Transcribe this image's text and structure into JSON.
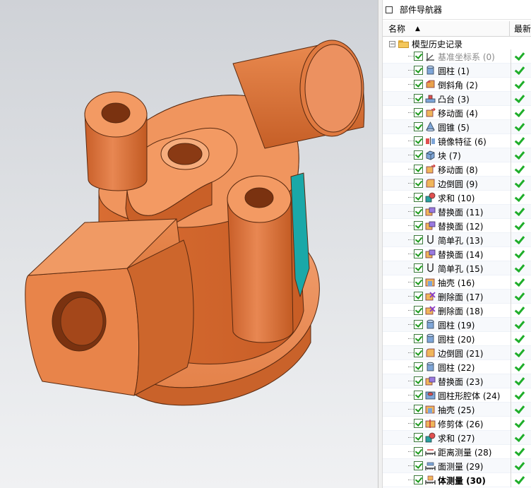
{
  "navigator": {
    "title": "部件导航器",
    "columns": {
      "name": "名称",
      "latest": "最新"
    },
    "root": {
      "label": "模型历史记录",
      "toggle": "−"
    },
    "features": [
      {
        "label": "基准坐标系 (0)",
        "icon": "datum-csys-icon",
        "muted": true
      },
      {
        "label": "圆柱 (1)",
        "icon": "cylinder-icon"
      },
      {
        "label": "倒斜角 (2)",
        "icon": "chamfer-icon"
      },
      {
        "label": "凸台 (3)",
        "icon": "boss-icon"
      },
      {
        "label": "移动面 (4)",
        "icon": "move-face-icon"
      },
      {
        "label": "圆锥 (5)",
        "icon": "cone-icon"
      },
      {
        "label": "镜像特征 (6)",
        "icon": "mirror-feature-icon"
      },
      {
        "label": "块 (7)",
        "icon": "block-icon"
      },
      {
        "label": "移动面 (8)",
        "icon": "move-face-icon"
      },
      {
        "label": "边倒圆 (9)",
        "icon": "edge-blend-icon"
      },
      {
        "label": "求和 (10)",
        "icon": "unite-icon"
      },
      {
        "label": "替换面 (11)",
        "icon": "replace-face-icon"
      },
      {
        "label": "替换面 (12)",
        "icon": "replace-face-icon"
      },
      {
        "label": "简单孔 (13)",
        "icon": "simple-hole-icon"
      },
      {
        "label": "替换面 (14)",
        "icon": "replace-face-icon"
      },
      {
        "label": "简单孔 (15)",
        "icon": "simple-hole-icon"
      },
      {
        "label": "抽壳 (16)",
        "icon": "shell-icon"
      },
      {
        "label": "删除面 (17)",
        "icon": "delete-face-icon"
      },
      {
        "label": "删除面 (18)",
        "icon": "delete-face-icon"
      },
      {
        "label": "圆柱 (19)",
        "icon": "cylinder-icon"
      },
      {
        "label": "圆柱 (20)",
        "icon": "cylinder-icon"
      },
      {
        "label": "边倒圆 (21)",
        "icon": "edge-blend-icon"
      },
      {
        "label": "圆柱 (22)",
        "icon": "cylinder-icon"
      },
      {
        "label": "替换面 (23)",
        "icon": "replace-face-icon"
      },
      {
        "label": "圆柱形腔体 (24)",
        "icon": "cylindrical-pocket-icon"
      },
      {
        "label": "抽壳 (25)",
        "icon": "shell-icon"
      },
      {
        "label": "修剪体 (26)",
        "icon": "trim-body-icon"
      },
      {
        "label": "求和 (27)",
        "icon": "unite-icon"
      },
      {
        "label": "距离测量 (28)",
        "icon": "distance-measure-icon"
      },
      {
        "label": "面测量 (29)",
        "icon": "area-measure-icon"
      },
      {
        "label": "体测量 (30)",
        "icon": "volume-measure-icon",
        "bold": true
      }
    ]
  },
  "model": {
    "color": "#e07a40",
    "accent_face": "#1aa8a8"
  }
}
